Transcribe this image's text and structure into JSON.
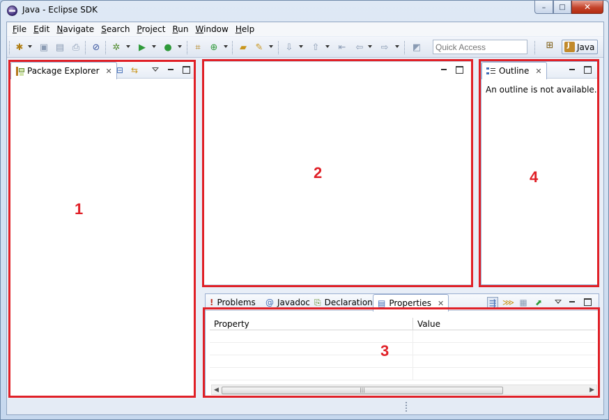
{
  "window": {
    "title": "Java - Eclipse SDK",
    "controls": {
      "minimize": "–",
      "maximize": "□",
      "close": "✕"
    }
  },
  "menu": [
    {
      "accel": "F",
      "rest": "ile"
    },
    {
      "accel": "E",
      "rest": "dit"
    },
    {
      "accel": "N",
      "rest": "avigate"
    },
    {
      "accel": "S",
      "rest": "earch"
    },
    {
      "accel": "P",
      "rest": "roject"
    },
    {
      "accel": "R",
      "rest": "un"
    },
    {
      "accel": "W",
      "rest": "indow"
    },
    {
      "accel": "H",
      "rest": "elp"
    }
  ],
  "toolbar": {
    "quick_access_placeholder": "Quick Access",
    "perspective": "Java",
    "icons": {
      "new": "✱",
      "save": "▣",
      "save_all": "▤",
      "print": "⎙",
      "skip_breakpoints": "⊘",
      "debug": "✲",
      "run": "▶",
      "run_external": "●",
      "new_java_project": "⌗",
      "new_class": "⊕",
      "open_type": "▰",
      "search": "✎",
      "next_annotation": "⇩",
      "prev_annotation": "⇧",
      "last_edit": "⇤",
      "back": "⇦",
      "forward": "⇨",
      "pin": "◩",
      "open_perspective": "⊞"
    }
  },
  "colors": {
    "annotation": "#e02027",
    "accent": "#3f6bb5"
  },
  "package_explorer": {
    "tab_label": "Package Explorer",
    "close": "✕",
    "collapse_all_icon": "⊟",
    "link_with_editor_icon": "⇆"
  },
  "outline": {
    "tab_label": "Outline",
    "close": "✕",
    "message": "An outline is not available."
  },
  "bottom_tabs": [
    {
      "label": "Problems",
      "icon": "!"
    },
    {
      "label": "Javadoc",
      "icon": "@"
    },
    {
      "label": "Declaration",
      "icon": "⎘"
    },
    {
      "label": "Properties",
      "icon": "▤"
    }
  ],
  "properties": {
    "close": "✕",
    "columns": [
      "Property",
      "Value"
    ],
    "rows": [
      [
        "",
        ""
      ],
      [
        "",
        ""
      ],
      [
        "",
        ""
      ],
      [
        "",
        ""
      ]
    ],
    "toolbar_icons": {
      "categories": "⇶",
      "filter": "⋙",
      "advanced": "▦",
      "restore_default": "⬈"
    },
    "scrollbar": {
      "left_arrow": "◀",
      "right_arrow": "▶",
      "thumb_grip": "|||"
    }
  },
  "regions": [
    "1",
    "2",
    "3",
    "4"
  ]
}
